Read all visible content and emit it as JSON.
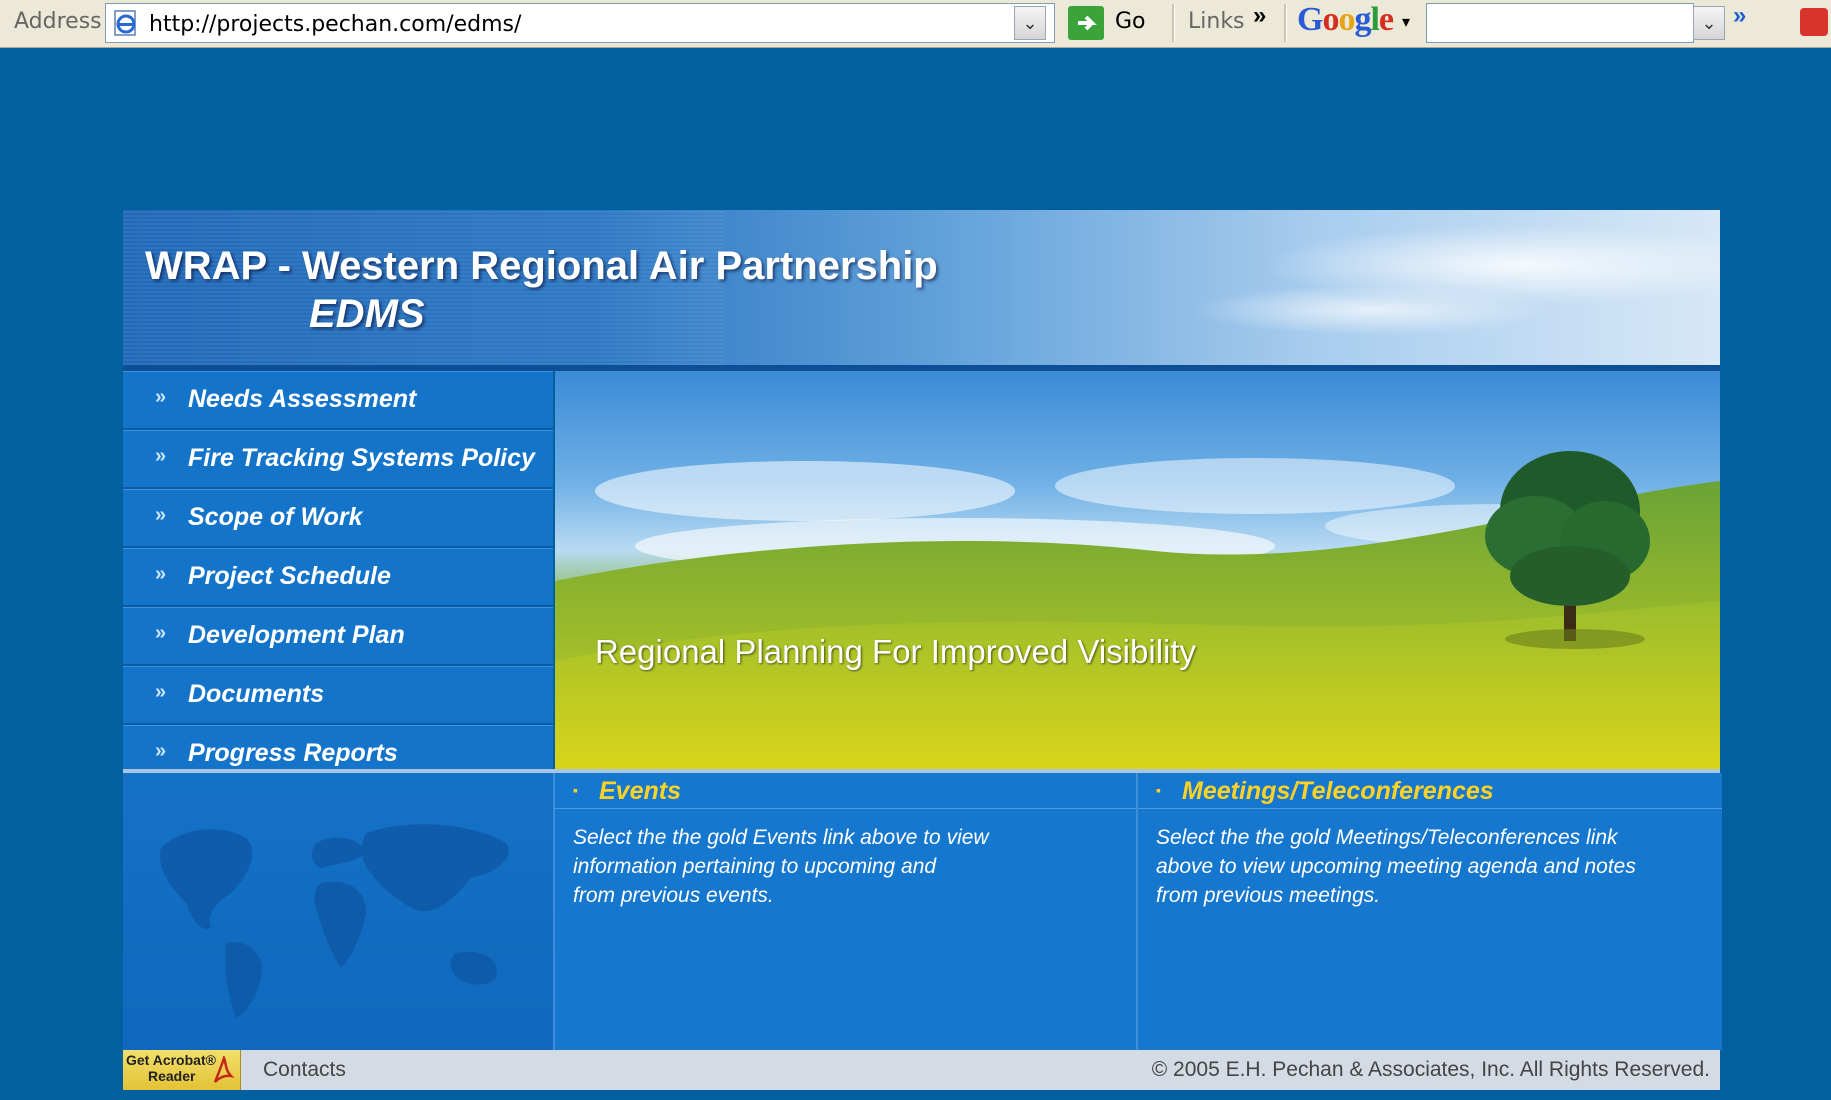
{
  "browser": {
    "address_label": "Address",
    "url": "http://projects.pechan.com/edms/",
    "go_label": "Go",
    "links_label": "Links",
    "google_label": "Google",
    "search_value": ""
  },
  "header": {
    "title": "WRAP - Western Regional Air Partnership",
    "subtitle": "EDMS"
  },
  "nav": {
    "items": [
      {
        "label": "Needs Assessment"
      },
      {
        "label": "Fire Tracking Systems Policy"
      },
      {
        "label": "Scope of Work"
      },
      {
        "label": "Project Schedule"
      },
      {
        "label": "Development Plan"
      },
      {
        "label": "Documents"
      },
      {
        "label": "Progress Reports"
      }
    ]
  },
  "hero": {
    "caption": "Regional Planning For Improved Visibility"
  },
  "events": {
    "title": "Events",
    "body_lines": [
      "Select the the gold Events link above to view",
      "information pertaining to upcoming and",
      "from previous events."
    ]
  },
  "meetings": {
    "title": "Meetings/Teleconferences",
    "body_lines": [
      "Select the the gold Meetings/Teleconferences link",
      "above to view upcoming meeting agenda and notes",
      "from previous meetings."
    ]
  },
  "footer": {
    "acrobat_line1": "Get Acrobat®",
    "acrobat_line2": "Reader",
    "contacts": "Contacts",
    "copyright": "© 2005  E.H. Pechan & Associates, Inc.  All Rights Reserved."
  },
  "colors": {
    "page_bg": "#03609f",
    "nav_bg": "#1374c9",
    "panel_title_gold": "#ffd226"
  }
}
